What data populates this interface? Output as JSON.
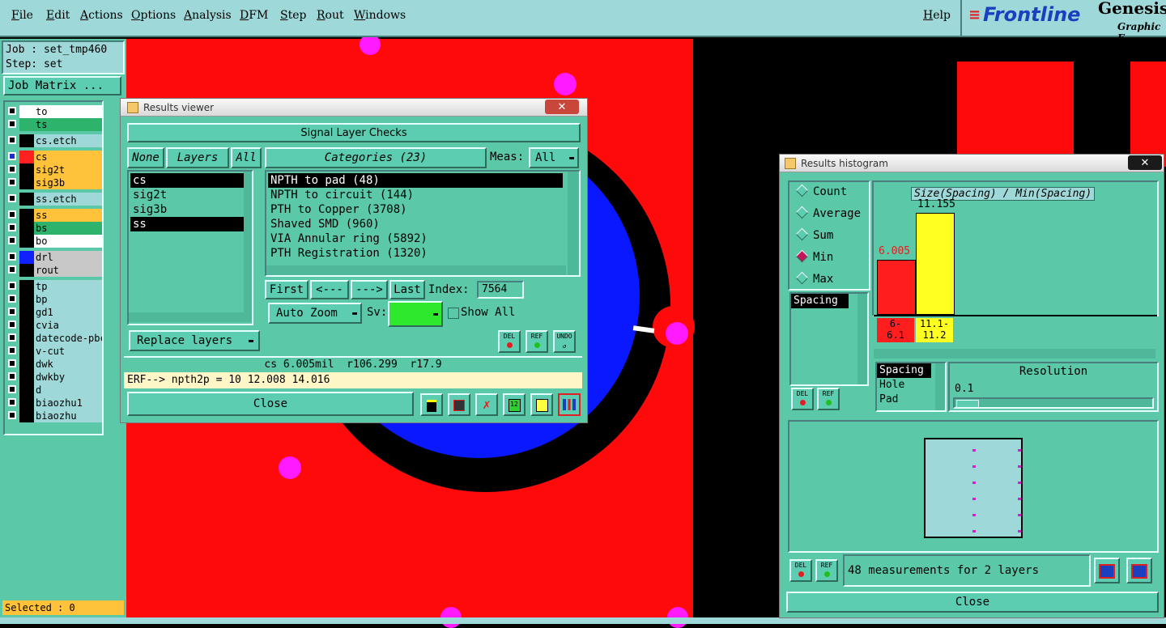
{
  "menubar": {
    "items": [
      "File",
      "Edit",
      "Actions",
      "Options",
      "Analysis",
      "DFM",
      "Step",
      "Rout",
      "Windows"
    ],
    "help": "Help",
    "brand": "Frontline",
    "product": "Genesis",
    "product_sub": "Graphic E"
  },
  "left_panel": {
    "job": "Job : set_tmp460",
    "step": "Step: set",
    "job_matrix": "Job Matrix ...",
    "layers": [
      {
        "name": "to",
        "color": "#ffffff",
        "bg": "#ffffff",
        "active": false
      },
      {
        "name": "ts",
        "color": "#2db36b",
        "bg": "#2db36b",
        "active": false
      },
      {
        "name": "cs.etch",
        "color": "",
        "bg": "#9ed8d8",
        "active": false
      },
      {
        "name": "cs",
        "color": "#ff2020",
        "bg": "#ffc23a",
        "active": true
      },
      {
        "name": "sig2t",
        "color": "",
        "bg": "#ffc23a",
        "active": false
      },
      {
        "name": "sig3b",
        "color": "",
        "bg": "#ffc23a",
        "active": false
      },
      {
        "name": "ss.etch",
        "color": "",
        "bg": "#9ed8d8",
        "active": false
      },
      {
        "name": "ss",
        "color": "",
        "bg": "#ffc23a",
        "active": false
      },
      {
        "name": "bs",
        "color": "",
        "bg": "#2db36b",
        "active": false
      },
      {
        "name": "bo",
        "color": "",
        "bg": "#ffffff",
        "active": false
      },
      {
        "name": "drl",
        "color": "#1020ff",
        "bg": "#c8c8c8",
        "active": false
      },
      {
        "name": "rout",
        "color": "",
        "bg": "#c8c8c8",
        "active": false
      },
      {
        "name": "tp",
        "color": "",
        "bg": "#9ed8d8",
        "active": false
      },
      {
        "name": "bp",
        "color": "",
        "bg": "#9ed8d8",
        "active": false
      },
      {
        "name": "gd1",
        "color": "",
        "bg": "#9ed8d8",
        "active": false
      },
      {
        "name": "cvia",
        "color": "",
        "bg": "#9ed8d8",
        "active": false
      },
      {
        "name": "datecode-pbc",
        "color": "",
        "bg": "#9ed8d8",
        "active": false
      },
      {
        "name": "v-cut",
        "color": "",
        "bg": "#9ed8d8",
        "active": false
      },
      {
        "name": "dwk",
        "color": "",
        "bg": "#9ed8d8",
        "active": false
      },
      {
        "name": "dwkby",
        "color": "",
        "bg": "#9ed8d8",
        "active": false
      },
      {
        "name": "d",
        "color": "",
        "bg": "#9ed8d8",
        "active": false
      },
      {
        "name": "biaozhu1",
        "color": "",
        "bg": "#9ed8d8",
        "active": false
      },
      {
        "name": "biaozhu",
        "color": "",
        "bg": "#9ed8d8",
        "active": false
      }
    ],
    "selected": "Selected : 0"
  },
  "results_viewer": {
    "title": "Results viewer",
    "header": "Signal Layer Checks",
    "none_btn": "None",
    "layers_btn": "Layers",
    "all_btn": "All",
    "layers": [
      "cs",
      "sig2t",
      "sig3b",
      "ss"
    ],
    "categories_btn": "Categories (23)",
    "meas_label": "Meas:",
    "meas_value": "All",
    "categories": [
      "NPTH to pad (48)",
      "NPTH to circuit (144)",
      "PTH to Copper (3708)",
      "Shaved SMD (960)",
      "VIA Annular ring (5892)",
      "PTH Registration (1320)"
    ],
    "first": "First",
    "prev": "<---",
    "next": "--->",
    "last": "Last",
    "index_label": "Index:",
    "index_value": "7564",
    "auto_zoom": "Auto Zoom",
    "sv_label": "Sv:",
    "show_all": "Show All",
    "replace_layers": "Replace layers",
    "status": "cs 6.005mil  r106.299  r17.9",
    "erf": "ERF--> npth2p = 10 12.008 14.016",
    "close": "Close",
    "del": "DEL",
    "ref": "REF",
    "undo": "UNDO"
  },
  "histogram": {
    "title": "Results histogram",
    "modes": [
      "Count",
      "Average",
      "Sum",
      "Min",
      "Max"
    ],
    "selected_mode": "Min",
    "chart_title": "Size(Spacing) / Min(Spacing)",
    "bars": [
      {
        "label": "6.005",
        "range": "6-\n6.1",
        "color": "#ff1e1e",
        "value": 6.005
      },
      {
        "label": "11.155",
        "range": "11.1-\n11.2",
        "color": "#ffff22",
        "value": 11.155
      }
    ],
    "list_top": [
      "Spacing"
    ],
    "list_attr": [
      "Spacing",
      "Hole",
      "Pad"
    ],
    "resolution_label": "Resolution",
    "resolution_value": "0.1",
    "measurements": "48 measurements for 2 layers",
    "close": "Close",
    "del": "DEL",
    "ref": "REF"
  }
}
